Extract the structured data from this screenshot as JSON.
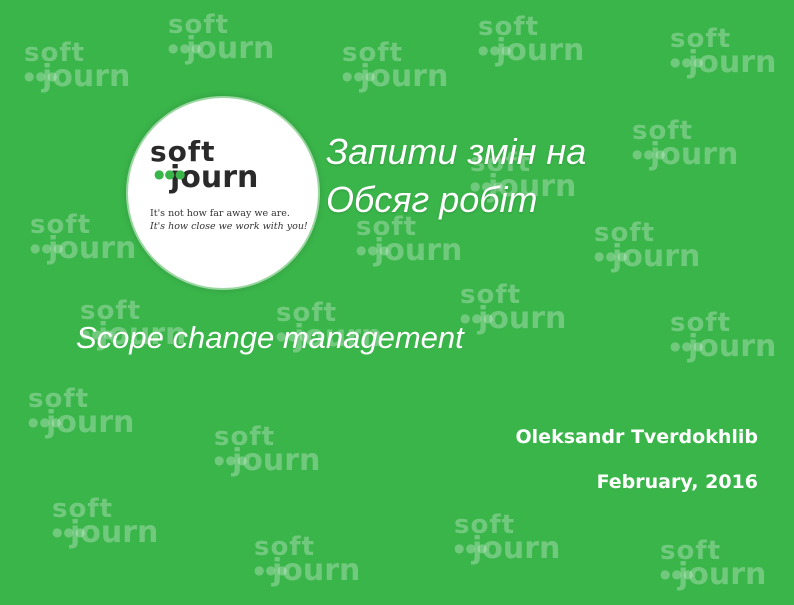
{
  "slide": {
    "background_color": "#3ab54a",
    "title_line1": "Запити змін на",
    "title_line2": "Обсяг робіт",
    "subtitle": "Scope change management",
    "author": "Oleksandr Tverdokhlib",
    "date": "February, 2016"
  },
  "logo": {
    "word1": "soft",
    "word2": "journ",
    "tagline_line1": "It's not how far away we are.",
    "tagline_line2": "It's how close we work with you!"
  },
  "watermark": {
    "word1": "soft",
    "word2": "journ"
  }
}
